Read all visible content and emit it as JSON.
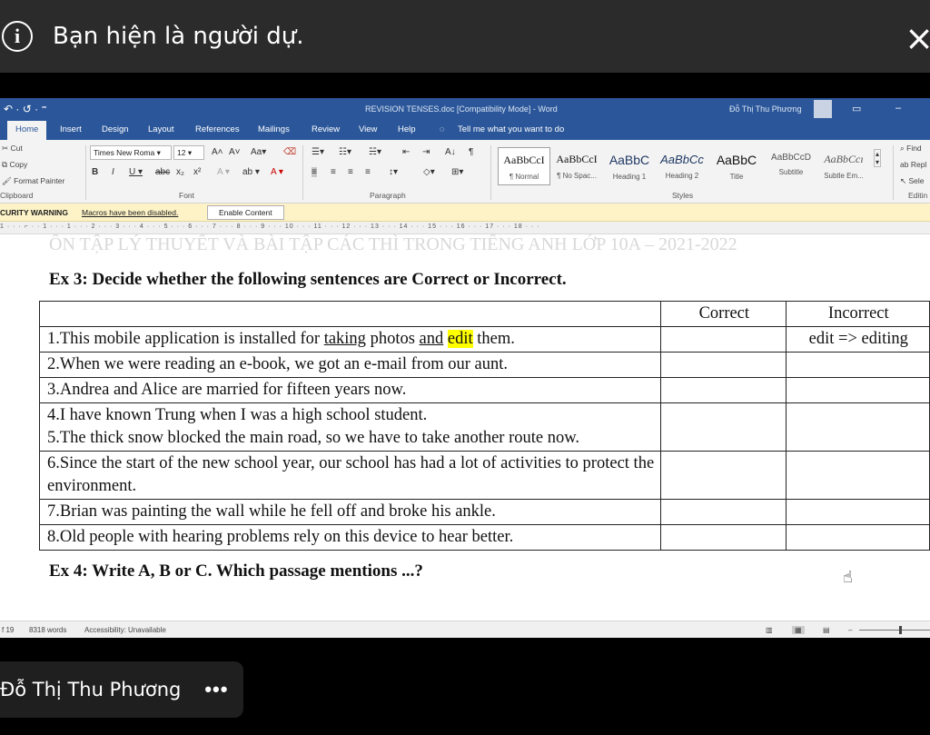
{
  "notification": {
    "message": "Bạn hiện là người dự.",
    "info_icon": "i",
    "close_icon": "×"
  },
  "word": {
    "quick_access": "↶ · ↺ · ⁼",
    "title": "REVISION TENSES.doc [Compatibility Mode]  -  Word",
    "user": "Đỗ Thị Thu Phương",
    "tabs": [
      "Home",
      "Insert",
      "Design",
      "Layout",
      "References",
      "Mailings",
      "Review",
      "View",
      "Help",
      "Tell me what you want to do"
    ],
    "clipboard": {
      "cut": "Cut",
      "copy": "Copy",
      "format_painter": "Format Painter",
      "group": "Clipboard"
    },
    "font": {
      "name": "Times New Roma",
      "size": "12",
      "group": "Font"
    },
    "paragraph_group": "Paragraph",
    "styles": [
      {
        "sample": "AaBbCcI",
        "name": "¶ Normal"
      },
      {
        "sample": "AaBbCcI",
        "name": "¶ No Spac..."
      },
      {
        "sample": "AaBbC",
        "name": "Heading 1"
      },
      {
        "sample": "AaBbCc",
        "name": "Heading 2"
      },
      {
        "sample": "AaBbC",
        "name": "Title"
      },
      {
        "sample": "AaBbCcD",
        "name": "Subtitle"
      },
      {
        "sample": "AaBbCcı",
        "name": "Subtle Em..."
      }
    ],
    "styles_group": "Styles",
    "editing": {
      "find": "Find",
      "replace": "Repl",
      "select": "Sele",
      "group": "Editin"
    },
    "security": {
      "warning": "CURITY WARNING",
      "macros": "Macros have been disabled.",
      "enable_button": "Enable Content"
    },
    "ruler": "1 · · · ⌐ · · 1 · · · 1 · · · 2 · · · 3 · · · 4 · · · 5 · · · 6 · · · 7 · · · 8 · · · 9 · · · 10 · · · 11 · · · 12 · · · 13 · · · 14 · · · 15 · · · 16 · · · 17 · · · 18 · · ·",
    "document": {
      "ghost_header": "ÔN TẬP LÝ THUYẾT VÀ BÀI TẬP CÁC THÌ TRONG TIẾNG ANH LỚP 10A – 2021-2022",
      "ex3_title": "Ex 3: Decide whether the following sentences are Correct or Incorrect.",
      "table": {
        "headers": [
          "",
          "Correct",
          "Incorrect"
        ],
        "row1": {
          "pre": "1.This mobile application is installed for ",
          "u1": "taking",
          "mid": " photos ",
          "u2": "and",
          "sp": " ",
          "hl": "edit",
          "post": " them.",
          "incorrect": "edit => editing"
        },
        "rows": [
          "2.When we were reading an e-book, we got an e-mail from our aunt.",
          "3.Andrea and Alice are married for fifteen years now.",
          "4.I have known Trung when I was a high school student.",
          "5.The thick snow blocked the main road, so we have to take another route now.",
          "6.Since the start of the new school year, our school has had a lot of activities to protect the environment.",
          "7.Brian was painting the wall while he fell off and broke his ankle.",
          "8.Old people with hearing problems rely on this device to hear better."
        ]
      },
      "ex4_title": "Ex 4: Write A, B or C. Which passage mentions ...?"
    },
    "status": {
      "page": "f 19",
      "words": "8318 words",
      "accessibility": "Accessibility: Unavailable"
    }
  },
  "participant": {
    "name": "Đỗ Thị Thu Phương",
    "more": "•••"
  }
}
